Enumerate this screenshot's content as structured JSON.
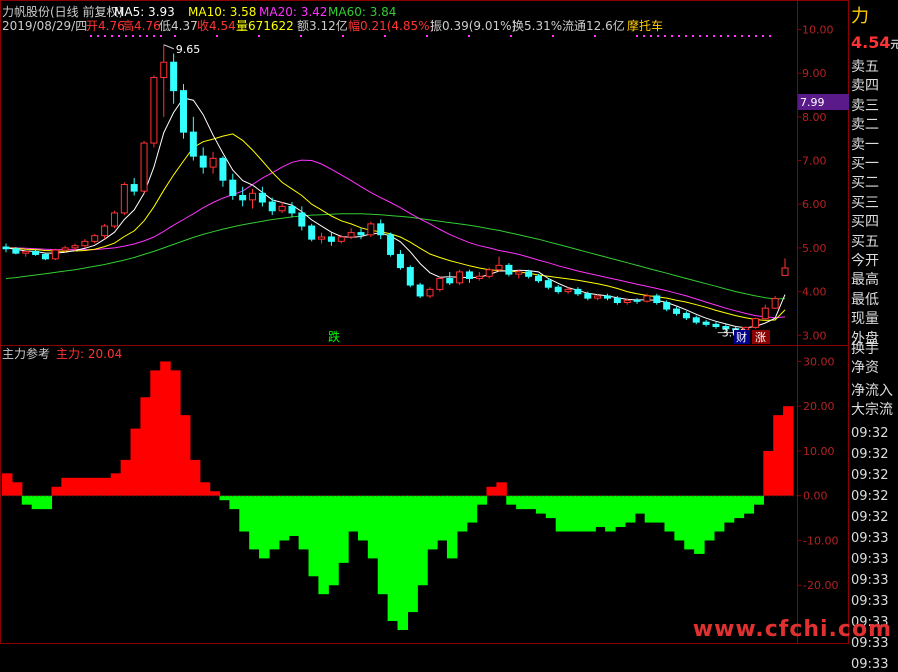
{
  "header": {
    "name": "力帆股份(日线 前复权)",
    "ma5": "MA5: 3.93",
    "ma10": "MA10: 3.58",
    "ma20": "MA20: 3.42",
    "ma60": "MA60: 3.84"
  },
  "infobar": {
    "date": "2019/08/29/四",
    "open": "开4.76",
    "high": "高4.76",
    "low": "低4.37",
    "close": "收4.54",
    "volume": "量671622",
    "amount": "额3.12亿",
    "change": "幅0.21(4.85%)",
    "amplitude": "振0.39(9.01%)",
    "turnover": "换5.31%",
    "float_cap": "流通12.6亿",
    "concept": "摩托车"
  },
  "annotations": {
    "peak": "9.65",
    "low": "3.06",
    "fall": "跌",
    "fin": "财",
    "rise": "涨",
    "marker": "7.99"
  },
  "indicator": {
    "title": "主力参考",
    "value_label": "主力: 20.04"
  },
  "right_panel": {
    "top_char": "力",
    "price": "4.54",
    "price_suffix": "元",
    "rows": [
      "卖五",
      "卖四",
      "卖三",
      "卖二",
      "卖一",
      "买一",
      "买二",
      "买三",
      "买四",
      "买五",
      "今开",
      "最高",
      "最低",
      "现量",
      "外盘",
      "换手",
      "净资",
      "净流入",
      "大宗流"
    ],
    "times": [
      "09:32",
      "09:32",
      "09:32",
      "09:32",
      "09:32",
      "09:33",
      "09:33",
      "09:33",
      "09:33",
      "09:33",
      "09:33",
      "09:33"
    ]
  },
  "watermark": "www.cfchi.com",
  "colors": {
    "up": "#ff3333",
    "down": "#33ffff",
    "ma5": "#ffffff",
    "ma10": "#ffff00",
    "ma20": "#ff33ff",
    "ma60": "#33cc33",
    "pos_bar": "#ff0000",
    "neg_bar": "#00ff00"
  },
  "chart_data": [
    {
      "type": "candlestick",
      "ylim": [
        2.8,
        10.4
      ],
      "yticks": [
        "3.00",
        "4.00",
        "5.00",
        "6.00",
        "7.00",
        "8.00",
        "9.00",
        "10.00"
      ],
      "candles": [
        [
          5.02,
          5.1,
          4.9,
          4.98
        ],
        [
          4.98,
          5.02,
          4.85,
          4.88
        ],
        [
          4.88,
          4.95,
          4.8,
          4.92
        ],
        [
          4.92,
          4.98,
          4.82,
          4.85
        ],
        [
          4.85,
          4.88,
          4.72,
          4.75
        ],
        [
          4.75,
          4.98,
          4.72,
          4.95
        ],
        [
          4.95,
          5.05,
          4.9,
          5.0
        ],
        [
          5.0,
          5.1,
          4.92,
          5.05
        ],
        [
          5.05,
          5.2,
          5.0,
          5.15
        ],
        [
          5.15,
          5.32,
          5.1,
          5.28
        ],
        [
          5.28,
          5.55,
          5.2,
          5.5
        ],
        [
          5.5,
          5.85,
          5.45,
          5.8
        ],
        [
          5.8,
          6.5,
          5.75,
          6.45
        ],
        [
          6.45,
          6.6,
          6.2,
          6.3
        ],
        [
          6.3,
          7.45,
          6.25,
          7.4
        ],
        [
          7.4,
          8.95,
          7.3,
          8.9
        ],
        [
          8.9,
          9.65,
          8.0,
          9.25
        ],
        [
          9.25,
          9.45,
          8.3,
          8.6
        ],
        [
          8.6,
          8.75,
          7.5,
          7.65
        ],
        [
          7.65,
          8.0,
          7.0,
          7.1
        ],
        [
          7.1,
          7.3,
          6.7,
          6.85
        ],
        [
          6.85,
          7.2,
          6.7,
          7.05
        ],
        [
          7.05,
          7.1,
          6.4,
          6.55
        ],
        [
          6.55,
          6.7,
          6.1,
          6.2
        ],
        [
          6.2,
          6.4,
          5.95,
          6.1
        ],
        [
          6.1,
          6.35,
          5.9,
          6.25
        ],
        [
          6.25,
          6.4,
          5.95,
          6.05
        ],
        [
          6.05,
          6.15,
          5.75,
          5.85
        ],
        [
          5.85,
          6.05,
          5.8,
          5.95
        ],
        [
          5.95,
          6.05,
          5.7,
          5.8
        ],
        [
          5.8,
          5.95,
          5.4,
          5.5
        ],
        [
          5.5,
          5.55,
          5.15,
          5.2
        ],
        [
          5.2,
          5.35,
          5.1,
          5.25
        ],
        [
          5.25,
          5.35,
          5.05,
          5.15
        ],
        [
          5.15,
          5.3,
          5.1,
          5.25
        ],
        [
          5.25,
          5.45,
          5.2,
          5.35
        ],
        [
          5.35,
          5.45,
          5.2,
          5.3
        ],
        [
          5.3,
          5.6,
          5.25,
          5.55
        ],
        [
          5.55,
          5.65,
          5.2,
          5.3
        ],
        [
          5.3,
          5.35,
          4.8,
          4.85
        ],
        [
          4.85,
          4.95,
          4.5,
          4.55
        ],
        [
          4.55,
          4.6,
          4.1,
          4.15
        ],
        [
          4.15,
          4.2,
          3.85,
          3.9
        ],
        [
          3.9,
          4.1,
          3.85,
          4.05
        ],
        [
          4.05,
          4.35,
          4.0,
          4.3
        ],
        [
          4.3,
          4.45,
          4.15,
          4.2
        ],
        [
          4.2,
          4.5,
          4.15,
          4.45
        ],
        [
          4.45,
          4.5,
          4.2,
          4.3
        ],
        [
          4.3,
          4.45,
          4.25,
          4.35
        ],
        [
          4.35,
          4.55,
          4.3,
          4.5
        ],
        [
          4.5,
          4.8,
          4.45,
          4.6
        ],
        [
          4.6,
          4.65,
          4.35,
          4.4
        ],
        [
          4.4,
          4.5,
          4.3,
          4.45
        ],
        [
          4.45,
          4.5,
          4.3,
          4.35
        ],
        [
          4.35,
          4.4,
          4.2,
          4.25
        ],
        [
          4.25,
          4.3,
          4.05,
          4.1
        ],
        [
          4.1,
          4.15,
          3.95,
          4.0
        ],
        [
          4.0,
          4.1,
          3.95,
          4.05
        ],
        [
          4.05,
          4.1,
          3.9,
          3.95
        ],
        [
          3.95,
          4.0,
          3.8,
          3.85
        ],
        [
          3.85,
          3.95,
          3.8,
          3.9
        ],
        [
          3.9,
          3.95,
          3.8,
          3.85
        ],
        [
          3.85,
          3.9,
          3.7,
          3.75
        ],
        [
          3.75,
          3.85,
          3.7,
          3.8
        ],
        [
          3.8,
          3.85,
          3.72,
          3.78
        ],
        [
          3.78,
          3.95,
          3.75,
          3.9
        ],
        [
          3.9,
          3.95,
          3.7,
          3.75
        ],
        [
          3.75,
          3.8,
          3.55,
          3.6
        ],
        [
          3.6,
          3.65,
          3.45,
          3.5
        ],
        [
          3.5,
          3.55,
          3.35,
          3.4
        ],
        [
          3.4,
          3.45,
          3.25,
          3.3
        ],
        [
          3.3,
          3.35,
          3.2,
          3.25
        ],
        [
          3.25,
          3.3,
          3.15,
          3.2
        ],
        [
          3.2,
          3.25,
          3.1,
          3.15
        ],
        [
          3.15,
          3.2,
          3.06,
          3.12
        ],
        [
          3.12,
          3.2,
          3.08,
          3.18
        ],
        [
          3.18,
          3.4,
          3.15,
          3.38
        ],
        [
          3.38,
          3.7,
          3.35,
          3.62
        ],
        [
          3.62,
          3.9,
          3.6,
          3.84
        ],
        [
          4.37,
          4.76,
          4.37,
          4.54
        ]
      ],
      "ma5": [
        5.0,
        4.97,
        4.93,
        4.92,
        4.88,
        4.88,
        4.9,
        4.94,
        4.99,
        5.06,
        5.2,
        5.36,
        5.65,
        5.87,
        6.25,
        6.85,
        7.64,
        8.1,
        8.43,
        8.38,
        8.05,
        7.58,
        7.17,
        6.78,
        6.54,
        6.44,
        6.27,
        6.1,
        6.04,
        5.98,
        5.83,
        5.64,
        5.5,
        5.36,
        5.26,
        5.24,
        5.26,
        5.32,
        5.34,
        5.27,
        5.14,
        4.91,
        4.64,
        4.43,
        4.33,
        4.34,
        4.33,
        4.32,
        4.33,
        4.39,
        4.47,
        4.47,
        4.49,
        4.48,
        4.45,
        4.3,
        4.19,
        4.09,
        4.03,
        3.96,
        3.93,
        3.9,
        3.86,
        3.82,
        3.81,
        3.81,
        3.8,
        3.75,
        3.67,
        3.58,
        3.48,
        3.39,
        3.32,
        3.26,
        3.2,
        3.17,
        3.2,
        3.28,
        3.39,
        3.93
      ],
      "ma10": [
        5.0,
        4.99,
        4.97,
        4.96,
        4.94,
        4.93,
        4.92,
        4.93,
        4.94,
        4.97,
        5.03,
        5.11,
        5.26,
        5.39,
        5.62,
        5.94,
        6.32,
        6.67,
        6.99,
        7.3,
        7.43,
        7.49,
        7.56,
        7.61,
        7.46,
        7.24,
        6.99,
        6.73,
        6.5,
        6.35,
        6.2,
        6.0,
        5.87,
        5.73,
        5.62,
        5.55,
        5.46,
        5.4,
        5.37,
        5.32,
        5.25,
        5.13,
        4.99,
        4.86,
        4.78,
        4.71,
        4.65,
        4.59,
        4.54,
        4.5,
        4.48,
        4.47,
        4.45,
        4.42,
        4.38,
        4.35,
        4.32,
        4.29,
        4.26,
        4.22,
        4.18,
        4.13,
        4.07,
        4.0,
        3.95,
        3.91,
        3.88,
        3.85,
        3.8,
        3.76,
        3.7,
        3.64,
        3.57,
        3.51,
        3.45,
        3.4,
        3.36,
        3.34,
        3.35,
        3.58
      ],
      "ma20": [
        5.0,
        5.0,
        4.99,
        4.98,
        4.97,
        4.96,
        4.96,
        4.96,
        4.96,
        4.96,
        4.98,
        5.0,
        5.04,
        5.09,
        5.16,
        5.25,
        5.38,
        5.52,
        5.65,
        5.78,
        5.92,
        6.04,
        6.14,
        6.22,
        6.3,
        6.45,
        6.6,
        6.72,
        6.85,
        6.96,
        7.01,
        7.0,
        6.92,
        6.8,
        6.67,
        6.54,
        6.4,
        6.27,
        6.15,
        6.04,
        5.92,
        5.79,
        5.66,
        5.55,
        5.42,
        5.31,
        5.21,
        5.12,
        5.05,
        5.0,
        4.94,
        4.9,
        4.85,
        4.79,
        4.72,
        4.66,
        4.59,
        4.53,
        4.47,
        4.42,
        4.37,
        4.32,
        4.27,
        4.22,
        4.17,
        4.12,
        4.07,
        4.02,
        3.96,
        3.9,
        3.83,
        3.76,
        3.69,
        3.62,
        3.56,
        3.5,
        3.45,
        3.42,
        3.4,
        3.42
      ],
      "ma60": [
        4.3,
        4.32,
        4.35,
        4.38,
        4.41,
        4.44,
        4.47,
        4.5,
        4.54,
        4.58,
        4.62,
        4.67,
        4.72,
        4.78,
        4.85,
        4.92,
        5.0,
        5.08,
        5.16,
        5.24,
        5.31,
        5.37,
        5.43,
        5.48,
        5.53,
        5.57,
        5.61,
        5.65,
        5.68,
        5.71,
        5.73,
        5.75,
        5.76,
        5.77,
        5.78,
        5.78,
        5.78,
        5.77,
        5.76,
        5.74,
        5.72,
        5.7,
        5.67,
        5.64,
        5.61,
        5.58,
        5.55,
        5.52,
        5.48,
        5.44,
        5.4,
        5.35,
        5.3,
        5.25,
        5.2,
        5.14,
        5.08,
        5.02,
        4.96,
        4.9,
        4.84,
        4.78,
        4.72,
        4.66,
        4.6,
        4.54,
        4.48,
        4.42,
        4.36,
        4.3,
        4.24,
        4.18,
        4.12,
        4.06,
        4.0,
        3.95,
        3.9,
        3.86,
        3.83,
        3.84
      ]
    },
    {
      "type": "bar",
      "series_name": "主力",
      "ylim": [
        -30,
        33
      ],
      "yticks": [
        "30.00",
        "20.00",
        "10.00",
        "0.00",
        "-10.00",
        "-20.00"
      ],
      "values": [
        5,
        3,
        -2,
        -3,
        -3,
        2,
        4,
        4,
        4,
        4,
        4,
        5,
        8,
        15,
        22,
        28,
        30,
        28,
        18,
        8,
        3,
        1,
        -1,
        -3,
        -8,
        -12,
        -14,
        -12,
        -10,
        -9,
        -12,
        -18,
        -22,
        -20,
        -15,
        -8,
        -10,
        -14,
        -22,
        -28,
        -30,
        -26,
        -20,
        -12,
        -10,
        -14,
        -8,
        -6,
        -2,
        2,
        3,
        -2,
        -3,
        -3,
        -4,
        -5,
        -8,
        -8,
        -8,
        -8,
        -7,
        -8,
        -7,
        -6,
        -4,
        -6,
        -6,
        -8,
        -10,
        -12,
        -13,
        -10,
        -8,
        -6,
        -5,
        -4,
        -2,
        10,
        18,
        20
      ]
    }
  ]
}
